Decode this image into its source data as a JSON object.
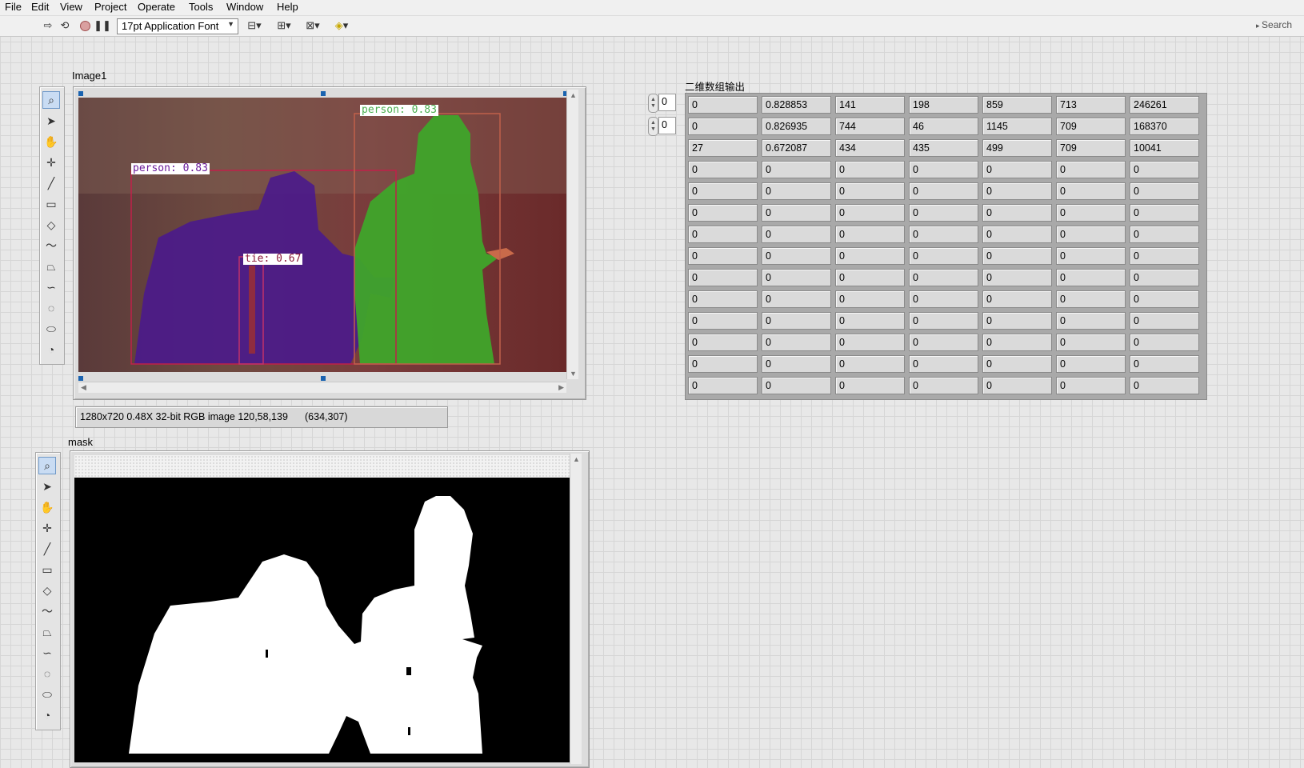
{
  "menu": [
    "File",
    "Edit",
    "View",
    "Project",
    "Operate",
    "Tools",
    "Window",
    "Help"
  ],
  "toolbar": {
    "font_select": "17pt Application Font",
    "search_label": "Search"
  },
  "image_display": {
    "label": "Image1",
    "status_info": "1280x720 0.48X 32-bit RGB image 120,58,139",
    "status_coords": "(634,307)",
    "detections": [
      {
        "label": "person: 0.83",
        "color": "#6a1b9a"
      },
      {
        "label": "person: 0.83",
        "color": "#4caf50"
      },
      {
        "label": "tie: 0.67",
        "color": "#8b1a3a"
      }
    ]
  },
  "mask_display": {
    "label": "mask"
  },
  "array_output": {
    "title": "二维数组输出",
    "row_index": "0",
    "col_index": "0",
    "rows": [
      [
        "0",
        "0.828853",
        "141",
        "198",
        "859",
        "713",
        "246261"
      ],
      [
        "0",
        "0.826935",
        "744",
        "46",
        "1145",
        "709",
        "168370"
      ],
      [
        "27",
        "0.672087",
        "434",
        "435",
        "499",
        "709",
        "10041"
      ],
      [
        "0",
        "0",
        "0",
        "0",
        "0",
        "0",
        "0"
      ],
      [
        "0",
        "0",
        "0",
        "0",
        "0",
        "0",
        "0"
      ],
      [
        "0",
        "0",
        "0",
        "0",
        "0",
        "0",
        "0"
      ],
      [
        "0",
        "0",
        "0",
        "0",
        "0",
        "0",
        "0"
      ],
      [
        "0",
        "0",
        "0",
        "0",
        "0",
        "0",
        "0"
      ],
      [
        "0",
        "0",
        "0",
        "0",
        "0",
        "0",
        "0"
      ],
      [
        "0",
        "0",
        "0",
        "0",
        "0",
        "0",
        "0"
      ],
      [
        "0",
        "0",
        "0",
        "0",
        "0",
        "0",
        "0"
      ],
      [
        "0",
        "0",
        "0",
        "0",
        "0",
        "0",
        "0"
      ],
      [
        "0",
        "0",
        "0",
        "0",
        "0",
        "0",
        "0"
      ],
      [
        "0",
        "0",
        "0",
        "0",
        "0",
        "0",
        "0"
      ]
    ]
  },
  "palette_tools": [
    "zoom-icon",
    "pointer-icon",
    "pan-icon",
    "crosshair-icon",
    "line-icon",
    "rectangle-icon",
    "rotated-rectangle-icon",
    "polyline-icon",
    "polygon-icon",
    "freehand-line-icon",
    "freehand-region-icon",
    "oval-icon",
    "annulus-icon"
  ]
}
